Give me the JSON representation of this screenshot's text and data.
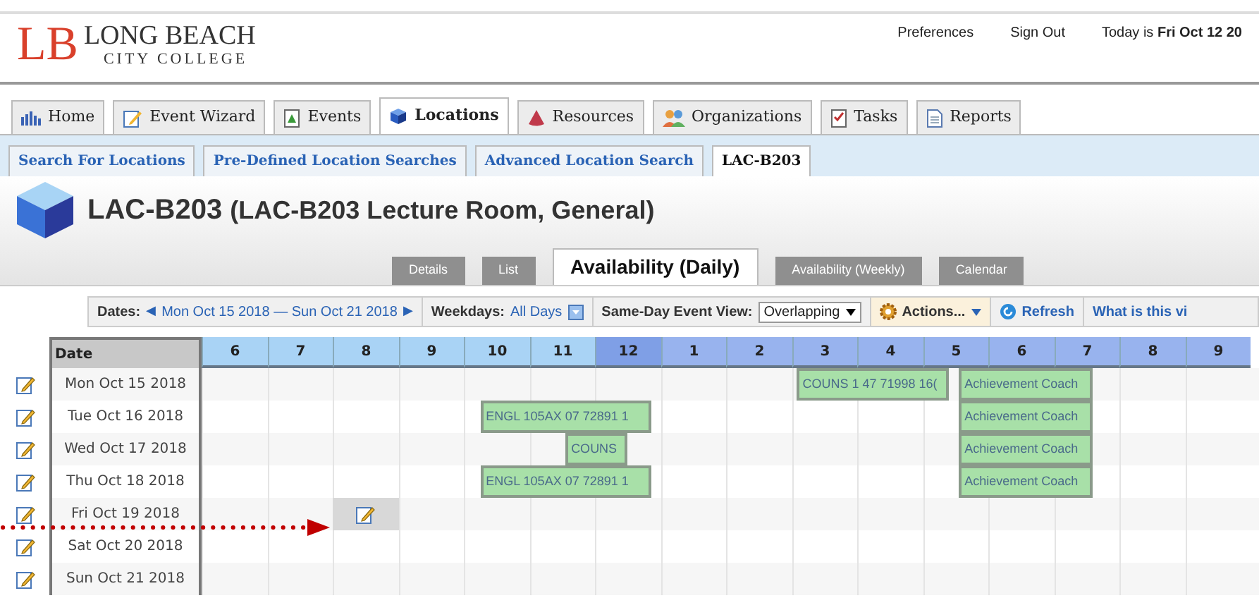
{
  "header": {
    "logo_mark": "LB",
    "logo_line1": "LONG BEACH",
    "logo_line2": "CITY COLLEGE",
    "links": [
      "Preferences",
      "Sign Out"
    ],
    "today_label": "Today is ",
    "today_value": "Fri Oct 12 20"
  },
  "tabs": [
    {
      "label": "Home",
      "selected": false
    },
    {
      "label": "Event Wizard",
      "selected": false
    },
    {
      "label": "Events",
      "selected": false
    },
    {
      "label": "Locations",
      "selected": true
    },
    {
      "label": "Resources",
      "selected": false
    },
    {
      "label": "Organizations",
      "selected": false
    },
    {
      "label": "Tasks",
      "selected": false
    },
    {
      "label": "Reports",
      "selected": false
    }
  ],
  "subtabs": [
    {
      "label": "Search For Locations",
      "selected": false
    },
    {
      "label": "Pre-Defined Location Searches",
      "selected": false
    },
    {
      "label": "Advanced Location Search",
      "selected": false
    },
    {
      "label": "LAC-B203",
      "selected": true
    }
  ],
  "location": {
    "name": "LAC-B203",
    "description": "(LAC-B203 Lecture Room, General)"
  },
  "view_tabs": [
    {
      "label": "Details",
      "selected": false
    },
    {
      "label": "List",
      "selected": false
    },
    {
      "label": "Availability (Daily)",
      "selected": true
    },
    {
      "label": "Availability (Weekly)",
      "selected": false
    },
    {
      "label": "Calendar",
      "selected": false
    }
  ],
  "toolbar": {
    "dates_label": "Dates:",
    "prev": "◀",
    "date_range": "Mon Oct 15 2018 — Sun Oct 21 2018",
    "next": "▶",
    "weekdays_label": "Weekdays:",
    "weekdays_value": "All Days",
    "view_label": "Same-Day Event View:",
    "view_value": "Overlapping",
    "actions": "Actions...",
    "refresh": "Refresh",
    "help": "What is this vi"
  },
  "grid": {
    "date_column": "Date",
    "hours": [
      {
        "label": "6",
        "kind": "am"
      },
      {
        "label": "7",
        "kind": "am"
      },
      {
        "label": "8",
        "kind": "am"
      },
      {
        "label": "9",
        "kind": "am"
      },
      {
        "label": "10",
        "kind": "am"
      },
      {
        "label": "11",
        "kind": "am"
      },
      {
        "label": "12",
        "kind": "noon"
      },
      {
        "label": "1",
        "kind": "pm"
      },
      {
        "label": "2",
        "kind": "pm"
      },
      {
        "label": "3",
        "kind": "pm"
      },
      {
        "label": "4",
        "kind": "pm"
      },
      {
        "label": "5",
        "kind": "pm"
      },
      {
        "label": "6",
        "kind": "pm"
      },
      {
        "label": "7",
        "kind": "pm"
      },
      {
        "label": "8",
        "kind": "pm"
      },
      {
        "label": "9",
        "kind": "pm"
      }
    ],
    "rows": [
      {
        "date": "Mon Oct 15 2018",
        "slot_selected": false,
        "events": [
          {
            "title": "COUNS 1 47 71998 16("
          },
          {
            "title": "Achievement Coach"
          }
        ]
      },
      {
        "date": "Tue Oct 16 2018",
        "slot_selected": false,
        "events": [
          {
            "title": "ENGL 105AX 07 72891 1"
          },
          {
            "title": "Achievement Coach"
          }
        ]
      },
      {
        "date": "Wed Oct 17 2018",
        "slot_selected": false,
        "events": [
          {
            "title": "COUNS"
          },
          {
            "title": "Achievement Coach"
          }
        ]
      },
      {
        "date": "Thu Oct 18 2018",
        "slot_selected": false,
        "events": [
          {
            "title": "ENGL 105AX 07 72891 1"
          },
          {
            "title": "Achievement Coach"
          }
        ]
      },
      {
        "date": "Fri Oct 19 2018",
        "slot_selected": true,
        "events": []
      },
      {
        "date": "Sat Oct 20 2018",
        "slot_selected": false,
        "events": []
      },
      {
        "date": "Sun Oct 21 2018",
        "slot_selected": false,
        "events": []
      }
    ]
  }
}
